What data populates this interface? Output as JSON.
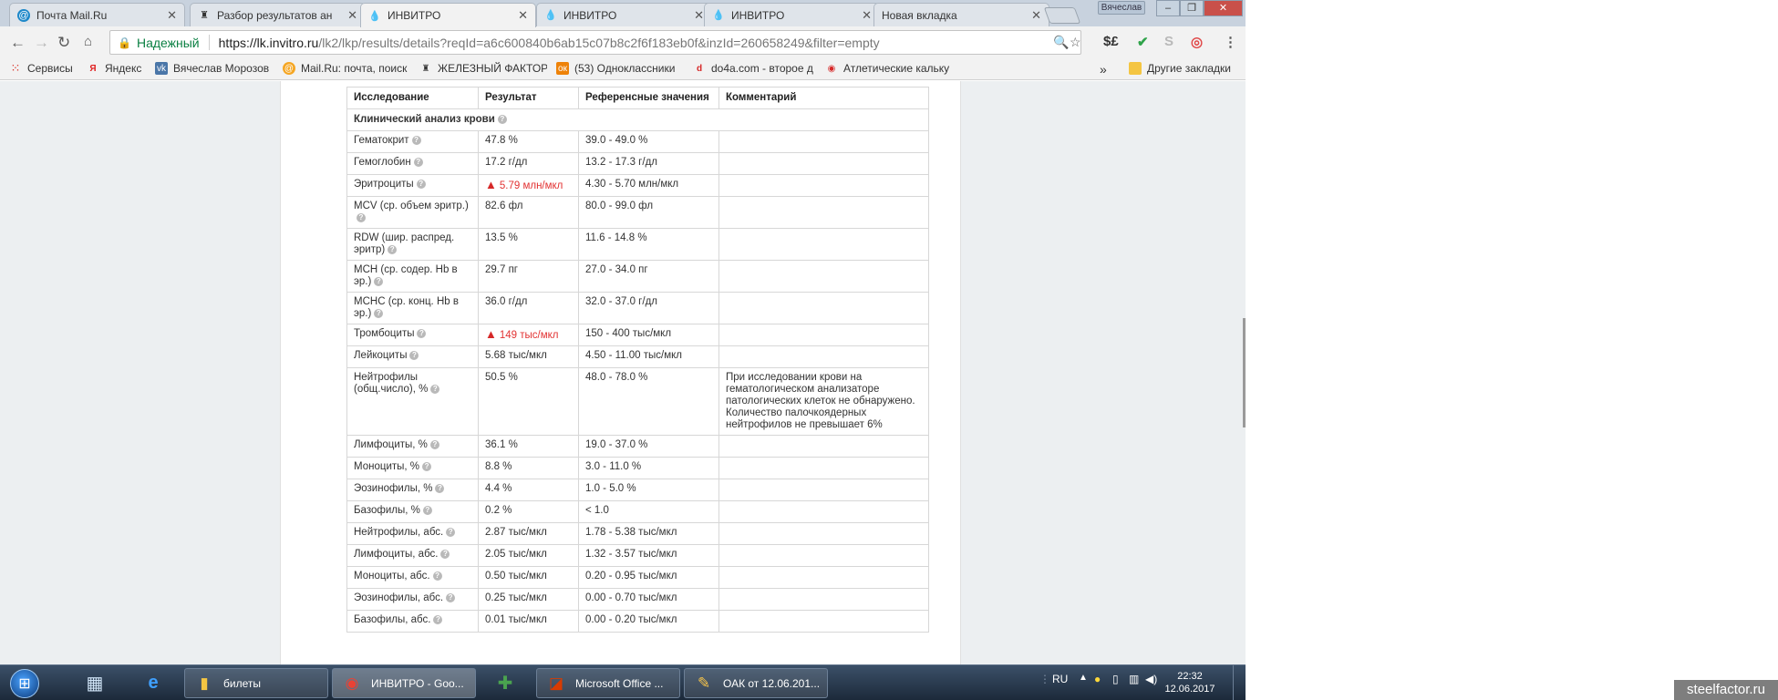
{
  "tabs": [
    {
      "title": "Почта Mail.Ru",
      "icon": "mailru-icon"
    },
    {
      "title": "Разбор результатов ан",
      "icon": "barbell-icon"
    },
    {
      "title": "ИНВИТРО",
      "icon": "invitro-drop-icon"
    },
    {
      "title": "ИНВИТРО",
      "icon": "invitro-drop-icon"
    },
    {
      "title": "ИНВИТРО",
      "icon": "invitro-drop-icon"
    },
    {
      "title": "Новая вкладка",
      "icon": ""
    }
  ],
  "window": {
    "user": "Вячеслав"
  },
  "address": {
    "secure_label": "Надежный",
    "url_host": "https://lk.invitro.ru",
    "url_rest": "/lk2/lkp/results/details?reqId=a6c600840b6ab15c07b8c2f6f183eb0f&inzId=260658249&filter=empty"
  },
  "bookmarks": [
    {
      "label": "Сервисы"
    },
    {
      "label": "Яндекс"
    },
    {
      "label": "Вячеслав Морозов"
    },
    {
      "label": "Mail.Ru: почта, поиск"
    },
    {
      "label": "ЖЕЛЕЗНЫЙ ФАКТОР"
    },
    {
      "label": "(53) Одноклассники"
    },
    {
      "label": "do4a.com - второе д"
    },
    {
      "label": "Атлетические кальку"
    }
  ],
  "bookmarks_overflow": "»",
  "other_bookmarks": "Другие закладки",
  "table": {
    "headers": [
      "Исследование",
      "Результат",
      "Референсные значения",
      "Комментарий"
    ],
    "group": "Клинический анализ крови",
    "rows": [
      {
        "name": "Гематокрит",
        "result": "47.8 %",
        "ref": "39.0 - 49.0 %",
        "comment": "",
        "flag": false
      },
      {
        "name": "Гемоглобин",
        "result": "17.2 г/дл",
        "ref": "13.2 - 17.3 г/дл",
        "comment": "",
        "flag": false
      },
      {
        "name": "Эритроциты",
        "result": "5.79 млн/мкл",
        "ref": "4.30 - 5.70 млн/мкл",
        "comment": "",
        "flag": true
      },
      {
        "name": "MCV (ср. объем эритр.)",
        "result": "82.6 фл",
        "ref": "80.0 - 99.0 фл",
        "comment": "",
        "flag": false
      },
      {
        "name": "RDW (шир. распред. эритр)",
        "result": "13.5 %",
        "ref": "11.6 - 14.8 %",
        "comment": "",
        "flag": false
      },
      {
        "name": "MCH (ср. содер. Hb в эр.)",
        "result": "29.7 пг",
        "ref": "27.0 - 34.0 пг",
        "comment": "",
        "flag": false
      },
      {
        "name": "MCHC (ср. конц. Hb в эр.)",
        "result": "36.0 г/дл",
        "ref": "32.0 - 37.0 г/дл",
        "comment": "",
        "flag": false
      },
      {
        "name": "Тромбоциты",
        "result": "149 тыс/мкл",
        "ref": "150 - 400 тыс/мкл",
        "comment": "",
        "flag": true
      },
      {
        "name": "Лейкоциты",
        "result": "5.68 тыс/мкл",
        "ref": "4.50 - 11.00 тыс/мкл",
        "comment": "",
        "flag": false
      },
      {
        "name": "Нейтрофилы (общ.число), %",
        "result": "50.5 %",
        "ref": "48.0 - 78.0 %",
        "comment": "При исследовании крови на гематологическом анализаторе патологических клеток не обнаружено. Количество палочкоядерных нейтрофилов не превышает 6%",
        "flag": false
      },
      {
        "name": "Лимфоциты, %",
        "result": "36.1 %",
        "ref": "19.0 - 37.0 %",
        "comment": "",
        "flag": false
      },
      {
        "name": "Моноциты, %",
        "result": "8.8 %",
        "ref": "3.0 - 11.0 %",
        "comment": "",
        "flag": false
      },
      {
        "name": "Эозинофилы, %",
        "result": "4.4 %",
        "ref": "1.0 - 5.0 %",
        "comment": "",
        "flag": false
      },
      {
        "name": "Базофилы, %",
        "result": "0.2 %",
        "ref": "< 1.0",
        "comment": "",
        "flag": false
      },
      {
        "name": "Нейтрофилы, абс.",
        "result": "2.87 тыс/мкл",
        "ref": "1.78 - 5.38 тыс/мкл",
        "comment": "",
        "flag": false
      },
      {
        "name": "Лимфоциты, абс.",
        "result": "2.05 тыс/мкл",
        "ref": "1.32 - 3.57 тыс/мкл",
        "comment": "",
        "flag": false
      },
      {
        "name": "Моноциты, абс.",
        "result": "0.50 тыс/мкл",
        "ref": "0.20 - 0.95 тыс/мкл",
        "comment": "",
        "flag": false
      },
      {
        "name": "Эозинофилы, абс.",
        "result": "0.25 тыс/мкл",
        "ref": "0.00 - 0.70 тыс/мкл",
        "comment": "",
        "flag": false
      },
      {
        "name": "Базофилы, абс.",
        "result": "0.01 тыс/мкл",
        "ref": "0.00 - 0.20 тыс/мкл",
        "comment": "",
        "flag": false
      }
    ]
  },
  "taskbar": {
    "tasks": [
      "билеты",
      "ИНВИТРО - Goo...",
      "Microsoft Office ...",
      "ОАК от 12.06.201..."
    ],
    "lang": "RU",
    "time": "22:32",
    "date": "12.06.2017"
  },
  "watermark": "steelfactor.ru",
  "colors": {
    "secure": "#0b8043",
    "warning": "#e23333",
    "taskbar": "#1c2a3a"
  }
}
